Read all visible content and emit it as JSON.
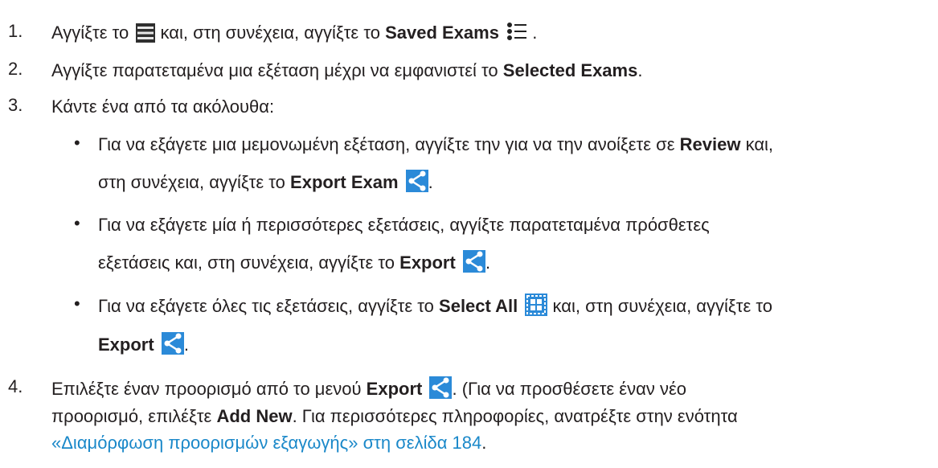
{
  "steps": [
    {
      "num": "1.",
      "text_a": "Αγγίξτε το",
      "text_b": "και, στη συνέχεια, αγγίξτε το",
      "bold_b": "Saved Exams",
      "text_c": "."
    },
    {
      "num": "2.",
      "text_a": "Αγγίξτε παρατεταμένα μια εξέταση μέχρι να εμφανιστεί το",
      "bold_a": "Selected Exams",
      "text_b": "."
    },
    {
      "num": "3.",
      "text_a": "Κάντε ένα από τα ακόλουθα:"
    },
    {
      "num": "4.",
      "text_a": "Επιλέξτε έναν προορισμό από το μενού",
      "bold_a": "Export",
      "text_b": ". (Για να προσθέσετε έναν νέο",
      "line2": "προορισμό, επιλέξτε",
      "bold_2": "Add New",
      "line2_b": ". Για περισσότερες πληροφορίες, ανατρέξτε στην ενότητα",
      "link": "«Διαμόρφωση προορισμών εξαγωγής» στη σελίδα 184",
      "line3_end": "."
    }
  ],
  "bullets": [
    {
      "marker": "•",
      "text_a": "Για να εξάγετε μια μεμονωμένη εξέταση, αγγίξτε την για να την ανοίξετε σε",
      "bold_a": "Review",
      "text_b": "και,",
      "line2": "στη συνέχεια, αγγίξτε το",
      "bold_2": "Export Exam",
      "line2_end": "."
    },
    {
      "marker": "•",
      "text_a": "Για να εξάγετε μία ή περισσότερες εξετάσεις, αγγίξτε παρατεταμένα πρόσθετες",
      "line2": "εξετάσεις και, στη συνέχεια, αγγίξτε το",
      "bold_2": "Export",
      "line2_end": "."
    },
    {
      "marker": "•",
      "text_a": "Για να εξάγετε όλες τις εξετάσεις, αγγίξτε το",
      "bold_a": "Select All",
      "text_b": "και, στη συνέχεια, αγγίξτε το",
      "line2_bold": "Export",
      "line2_end": "."
    }
  ],
  "icons": {
    "menu": "menu-icon",
    "list": "list-icon",
    "share": "share-icon",
    "select_all": "select-all-icon"
  },
  "colors": {
    "text": "#231f20",
    "link": "#1a88c9",
    "icon_blue": "#2b8ad8"
  }
}
